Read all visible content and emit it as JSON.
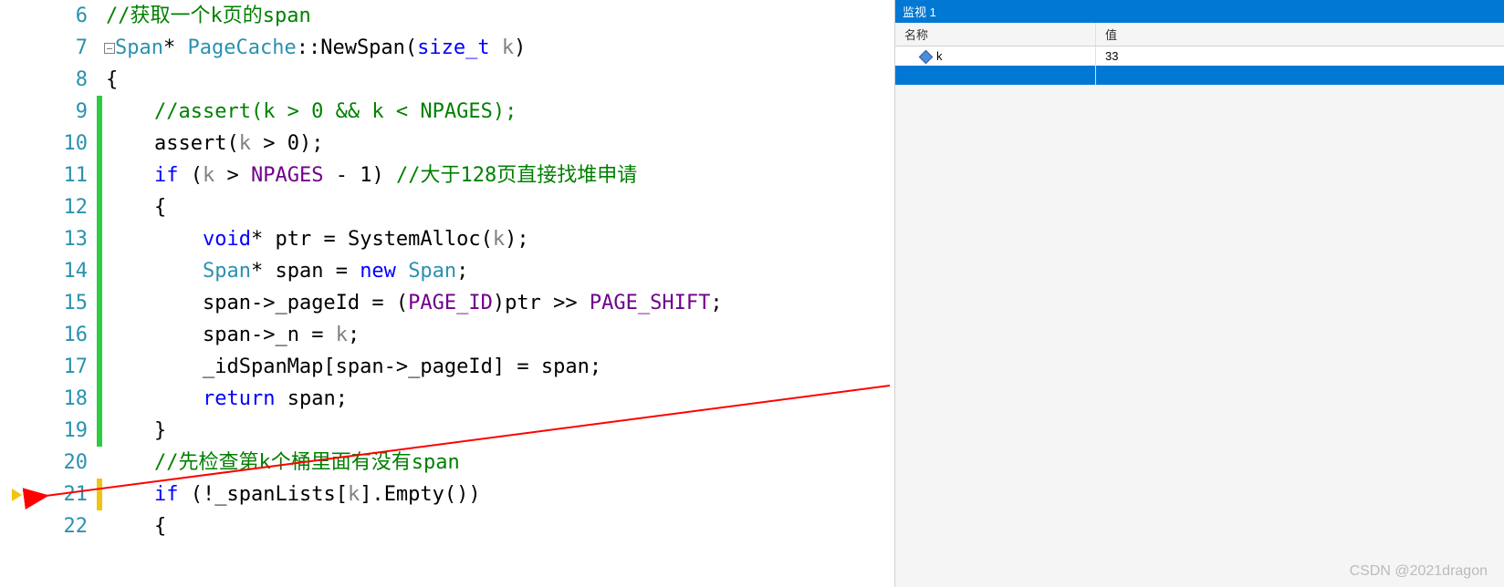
{
  "lines": [
    {
      "n": 6,
      "bar": "",
      "html": "<span class='c-comment'>//获取一个k页的span</span>"
    },
    {
      "n": 7,
      "bar": "",
      "fold": true,
      "html": "<span class='c-type'>Span</span><span class='c-punct'>* </span><span class='c-type'>PageCache</span><span class='c-punct'>::</span><span class='c-ident'>NewSpan</span><span class='c-punct'>(</span><span class='c-keyword'>size_t</span> <span class='c-param'>k</span><span class='c-punct'>)</span>"
    },
    {
      "n": 8,
      "bar": "",
      "html": "<span class='c-punct'>{</span>"
    },
    {
      "n": 9,
      "bar": "green",
      "html": "    <span class='c-comment'>//assert(k &gt; 0 &amp;&amp; k &lt; NPAGES);</span>"
    },
    {
      "n": 10,
      "bar": "green",
      "html": "    <span class='c-ident'>assert</span><span class='c-punct'>(</span><span class='c-param'>k</span> <span class='c-punct'>&gt;</span> <span class='c-ident'>0</span><span class='c-punct'>);</span>"
    },
    {
      "n": 11,
      "bar": "green",
      "html": "    <span class='c-keyword'>if</span> <span class='c-punct'>(</span><span class='c-param'>k</span> <span class='c-punct'>&gt;</span> <span class='c-macro'>NPAGES</span> <span class='c-punct'>-</span> <span class='c-ident'>1</span><span class='c-punct'>)</span> <span class='c-comment'>//大于128页直接找堆申请</span>"
    },
    {
      "n": 12,
      "bar": "green",
      "html": "    <span class='c-punct'>{</span>"
    },
    {
      "n": 13,
      "bar": "green",
      "html": "        <span class='c-keyword'>void</span><span class='c-punct'>*</span> <span class='c-ident'>ptr</span> <span class='c-punct'>=</span> <span class='c-ident'>SystemAlloc</span><span class='c-punct'>(</span><span class='c-param'>k</span><span class='c-punct'>);</span>"
    },
    {
      "n": 14,
      "bar": "green",
      "html": "        <span class='c-type'>Span</span><span class='c-punct'>*</span> <span class='c-ident'>span</span> <span class='c-punct'>=</span> <span class='c-keyword'>new</span> <span class='c-type'>Span</span><span class='c-punct'>;</span>"
    },
    {
      "n": 15,
      "bar": "green",
      "html": "        <span class='c-ident'>span</span><span class='c-punct'>-&gt;</span><span class='c-ident'>_pageId</span> <span class='c-punct'>= (</span><span class='c-macro'>PAGE_ID</span><span class='c-punct'>)</span><span class='c-ident'>ptr</span> <span class='c-punct'>&gt;&gt;</span> <span class='c-macro'>PAGE_SHIFT</span><span class='c-punct'>;</span>"
    },
    {
      "n": 16,
      "bar": "green",
      "html": "        <span class='c-ident'>span</span><span class='c-punct'>-&gt;</span><span class='c-ident'>_n</span> <span class='c-punct'>=</span> <span class='c-param'>k</span><span class='c-punct'>;</span>"
    },
    {
      "n": 17,
      "bar": "green",
      "html": "        <span class='c-ident'>_idSpanMap</span><span class='c-punct'>[</span><span class='c-ident'>span</span><span class='c-punct'>-&gt;</span><span class='c-ident'>_pageId</span><span class='c-punct'>] =</span> <span class='c-ident'>span</span><span class='c-punct'>;</span>"
    },
    {
      "n": 18,
      "bar": "green",
      "html": "        <span class='c-keyword'>return</span> <span class='c-ident'>span</span><span class='c-punct'>;</span>"
    },
    {
      "n": 19,
      "bar": "green",
      "html": "    <span class='c-punct'>}</span>"
    },
    {
      "n": 20,
      "bar": "",
      "html": "    <span class='c-comment'>//先检查第k个桶里面有没有span</span>"
    },
    {
      "n": 21,
      "bar": "yellow",
      "current": true,
      "html": "    <span class='c-keyword'>if</span> <span class='c-punct'>(!</span><span class='c-ident'>_spanLists</span><span class='c-punct'>[</span><span class='c-param'>k</span><span class='c-punct'>].</span><span class='c-ident'>Empty</span><span class='c-punct'>())</span>"
    },
    {
      "n": 22,
      "bar": "",
      "html": "    <span class='c-punct'>{</span>"
    }
  ],
  "watch": {
    "title": "监视 1",
    "headers": {
      "name": "名称",
      "value": "值"
    },
    "rows": [
      {
        "name": "k",
        "value": "33"
      }
    ]
  },
  "watermark": "CSDN @2021dragon"
}
